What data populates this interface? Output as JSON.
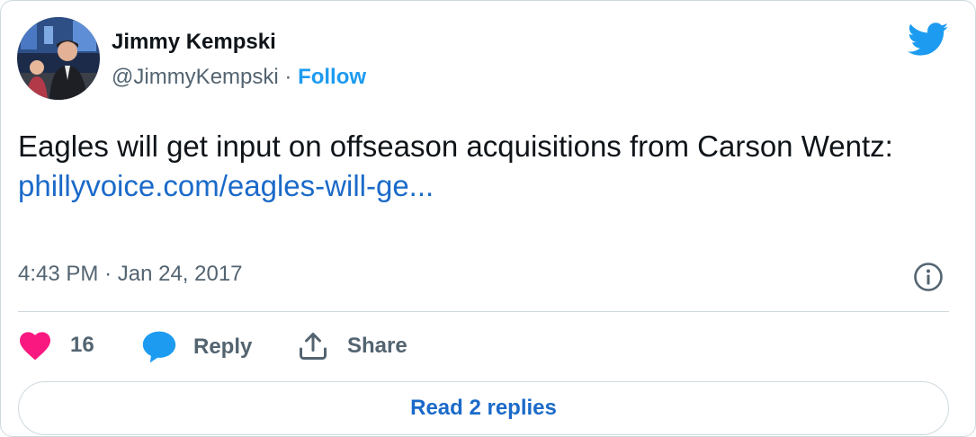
{
  "author": {
    "name": "Jimmy Kempski",
    "handle": "@JimmyKempski",
    "separator": "·",
    "follow_label": "Follow"
  },
  "tweet": {
    "text": "Eagles will get input on offseason acquisitions from Carson Wentz:",
    "link_text": "phillyvoice.com/eagles-will-ge...",
    "time": "4:43 PM",
    "time_separator": "·",
    "date": "Jan 24, 2017"
  },
  "actions": {
    "like_count": "16",
    "reply_label": "Reply",
    "share_label": "Share"
  },
  "read_replies_label": "Read 2 replies",
  "colors": {
    "brand_blue": "#1d9bf0",
    "link_blue": "#1b6ac9",
    "heart_pink": "#f91880",
    "text_gray": "#536471",
    "border": "#cfd9de"
  },
  "icons": {
    "bird": "twitter-bird-icon",
    "info": "info-icon",
    "like": "heart-icon",
    "reply": "speech-bubble-icon",
    "share": "share-upload-icon"
  }
}
